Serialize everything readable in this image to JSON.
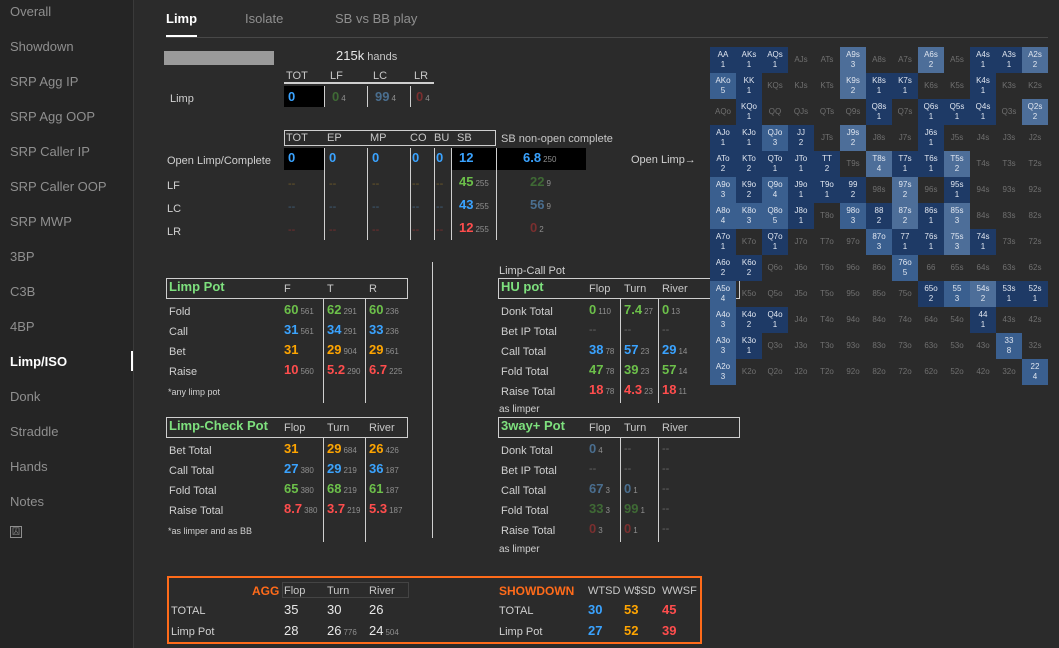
{
  "sidebar": {
    "items": [
      "Overall",
      "Showdown",
      "SRP Agg IP",
      "SRP Agg OOP",
      "SRP Caller IP",
      "SRP Caller OOP",
      "SRP MWP",
      "3BP",
      "C3B",
      "4BP",
      "Limp/ISO",
      "Donk",
      "Straddle",
      "Hands",
      "Notes"
    ],
    "active": "Limp/ISO",
    "icon_glyph": "囚"
  },
  "tabs": [
    "Limp",
    "Isolate",
    "SB vs BB play"
  ],
  "header": {
    "hands": "215k",
    "hands_label": "hands"
  },
  "limp": {
    "cols": [
      "TOT",
      "LF",
      "LC",
      "LR"
    ],
    "label": "Limp",
    "values": [
      {
        "v": "0"
      },
      {
        "v": "0",
        "s": "4"
      },
      {
        "v": "99",
        "s": "4"
      },
      {
        "v": "0",
        "s": "4"
      }
    ]
  },
  "open": {
    "cols": [
      "TOT",
      "EP",
      "MP",
      "CO",
      "BU",
      "SB"
    ],
    "extra_col": "SB non-open complete",
    "rows": [
      "Open Limp/Complete",
      "LF",
      "LC",
      "LR"
    ],
    "open_vals": [
      "0",
      "0",
      "0",
      "0",
      "0",
      "12"
    ],
    "sb_extra": {
      "v": "6.8",
      "s": "250"
    },
    "sb_lf": {
      "v": "45",
      "s": "255"
    },
    "sb_lc": {
      "v": "43",
      "s": "255"
    },
    "sb_lr": {
      "v": "12",
      "s": "255"
    },
    "ex_lf": {
      "v": "22",
      "s": "9"
    },
    "ex_lc": {
      "v": "56",
      "s": "9"
    },
    "ex_lr": {
      "v": "0",
      "s": "2"
    },
    "dash": "--",
    "open_limp_arrow": "Open Limp→"
  },
  "limp_pot": {
    "title": "Limp Pot",
    "cols": [
      "F",
      "T",
      "R"
    ],
    "rows": [
      {
        "label": "Fold",
        "vals": [
          {
            "v": "60",
            "s": "561"
          },
          {
            "v": "62",
            "s": "291"
          },
          {
            "v": "60",
            "s": "236"
          }
        ]
      },
      {
        "label": "Call",
        "vals": [
          {
            "v": "31",
            "s": "561"
          },
          {
            "v": "34",
            "s": "291"
          },
          {
            "v": "33",
            "s": "236"
          }
        ]
      },
      {
        "label": "Bet",
        "vals": [
          {
            "v": "31"
          },
          {
            "v": "29",
            "s": "904"
          },
          {
            "v": "29",
            "s": "561"
          }
        ]
      },
      {
        "label": "Raise",
        "vals": [
          {
            "v": "10",
            "s": "560"
          },
          {
            "v": "5.2",
            "s": "290"
          },
          {
            "v": "6.7",
            "s": "225"
          }
        ]
      }
    ],
    "note": "*any limp pot"
  },
  "limp_check": {
    "title": "Limp-Check Pot",
    "cols": [
      "Flop",
      "Turn",
      "River"
    ],
    "rows": [
      {
        "label": "Bet Total",
        "vals": [
          {
            "v": "31"
          },
          {
            "v": "29",
            "s": "684"
          },
          {
            "v": "26",
            "s": "426"
          }
        ]
      },
      {
        "label": "Call Total",
        "vals": [
          {
            "v": "27",
            "s": "380"
          },
          {
            "v": "29",
            "s": "219"
          },
          {
            "v": "36",
            "s": "187"
          }
        ]
      },
      {
        "label": "Fold Total",
        "vals": [
          {
            "v": "65",
            "s": "380"
          },
          {
            "v": "68",
            "s": "219"
          },
          {
            "v": "61",
            "s": "187"
          }
        ]
      },
      {
        "label": "Raise Total",
        "vals": [
          {
            "v": "8.7",
            "s": "380"
          },
          {
            "v": "3.7",
            "s": "219"
          },
          {
            "v": "5.3",
            "s": "187"
          }
        ]
      }
    ],
    "note": "*as limper and as BB"
  },
  "limp_call": {
    "header": "Limp-Call Pot",
    "title": "HU pot",
    "cols": [
      "Flop",
      "Turn",
      "River"
    ],
    "rows": [
      {
        "label": "Donk Total",
        "vals": [
          {
            "v": "0",
            "s": "110"
          },
          {
            "v": "7.4",
            "s": "27"
          },
          {
            "v": "0",
            "s": "13"
          }
        ]
      },
      {
        "label": "Bet IP Total",
        "vals": [
          {
            "v": "--"
          },
          {
            "v": "--"
          },
          {
            "v": "--"
          }
        ]
      },
      {
        "label": "Call Total",
        "vals": [
          {
            "v": "38",
            "s": "78"
          },
          {
            "v": "57",
            "s": "23"
          },
          {
            "v": "29",
            "s": "14"
          }
        ]
      },
      {
        "label": "Fold Total",
        "vals": [
          {
            "v": "47",
            "s": "78"
          },
          {
            "v": "39",
            "s": "23"
          },
          {
            "v": "57",
            "s": "14"
          }
        ]
      },
      {
        "label": "Raise Total",
        "vals": [
          {
            "v": "18",
            "s": "78"
          },
          {
            "v": "4.3",
            "s": "23"
          },
          {
            "v": "18",
            "s": "11"
          }
        ]
      }
    ],
    "note": "as limper"
  },
  "three_way": {
    "title": "3way+ Pot",
    "cols": [
      "Flop",
      "Turn",
      "River"
    ],
    "rows": [
      {
        "label": "Donk Total",
        "vals": [
          {
            "v": "0",
            "s": "4"
          },
          {
            "v": "--"
          },
          {
            "v": "--"
          }
        ]
      },
      {
        "label": "Bet IP Total",
        "vals": [
          {
            "v": "--"
          },
          {
            "v": "--"
          },
          {
            "v": "--"
          }
        ]
      },
      {
        "label": "Call Total",
        "vals": [
          {
            "v": "67",
            "s": "3"
          },
          {
            "v": "0",
            "s": "1"
          },
          {
            "v": "--"
          }
        ]
      },
      {
        "label": "Fold Total",
        "vals": [
          {
            "v": "33",
            "s": "3"
          },
          {
            "v": "99",
            "s": "1"
          },
          {
            "v": "--"
          }
        ]
      },
      {
        "label": "Raise Total",
        "vals": [
          {
            "v": "0",
            "s": "3"
          },
          {
            "v": "0",
            "s": "1"
          },
          {
            "v": "--"
          }
        ]
      }
    ],
    "note": "as limper"
  },
  "agg": {
    "title": "AGG",
    "cols": [
      "Flop",
      "Turn",
      "River"
    ],
    "rows": [
      {
        "label": "TOTAL",
        "vals": [
          {
            "v": "35"
          },
          {
            "v": "30"
          },
          {
            "v": "26"
          }
        ]
      },
      {
        "label": "Limp Pot",
        "vals": [
          {
            "v": "28"
          },
          {
            "v": "26",
            "s": "776"
          },
          {
            "v": "24",
            "s": "504"
          }
        ]
      }
    ]
  },
  "showdown": {
    "title": "SHOWDOWN",
    "cols": [
      "WTSD",
      "W$SD",
      "WWSF"
    ],
    "rows": [
      {
        "label": "TOTAL",
        "vals": [
          {
            "v": "30"
          },
          {
            "v": "53"
          },
          {
            "v": "45"
          }
        ]
      },
      {
        "label": "Limp Pot",
        "vals": [
          {
            "v": "27"
          },
          {
            "v": "52"
          },
          {
            "v": "39"
          }
        ]
      }
    ]
  },
  "grid": {
    "ranks": [
      "A",
      "K",
      "Q",
      "J",
      "T",
      "9",
      "8",
      "7",
      "6",
      "5",
      "4",
      "3",
      "2"
    ],
    "highlight": {
      "AA": "1",
      "AKs": "1",
      "AQs": "1",
      "A9s": "3",
      "A6s": "2",
      "A4s": "1",
      "A3s": "1",
      "A2s": "2",
      "AKo": "5",
      "KK": "1",
      "K9s": "2",
      "K8s": "1",
      "K7s": "1",
      "K4s": "1",
      "KQo": "1",
      "Q8s": "1",
      "Q6s": "1",
      "Q5s": "1",
      "Q4s": "1",
      "Q2s": "2",
      "AJo": "1",
      "KJo": "1",
      "QJo": "3",
      "JJ": "2",
      "J9s": "2",
      "J6s": "1",
      "ATo": "2",
      "KTo": "2",
      "QTo": "1",
      "JTo": "1",
      "TT": "2",
      "T8s": "4",
      "T7s": "1",
      "T6s": "1",
      "T5s": "2",
      "A9o": "3",
      "K9o": "2",
      "Q9o": "4",
      "J9o": "1",
      "T9o": "1",
      "99": "2",
      "97s": "2",
      "95s": "1",
      "A8o": "4",
      "K8o": "3",
      "Q8o": "5",
      "J8o": "1",
      "98o": "3",
      "88": "2",
      "87s": "2",
      "86s": "1",
      "85s": "3",
      "A7o": "1",
      "Q7o": "1",
      "87o": "3",
      "77": "1",
      "76s": "1",
      "75s": "3",
      "74s": "1",
      "A6o": "2",
      "K6o": "2",
      "76o": "5",
      "A5o": "4",
      "65o": "2",
      "55": "3",
      "54s": "2",
      "53s": "1",
      "52s": "1",
      "A4o": "3",
      "K4o": "2",
      "Q4o": "1",
      "44": "1",
      "A3o": "3",
      "K3o": "1",
      "33": "8",
      "A2o": "3",
      "22": "4"
    }
  }
}
